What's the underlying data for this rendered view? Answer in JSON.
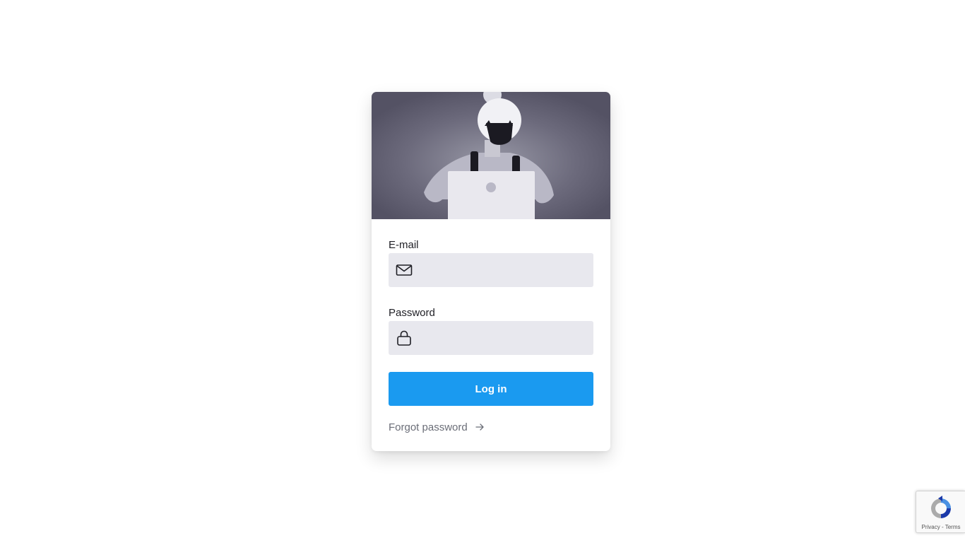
{
  "login": {
    "email_label": "E-mail",
    "email_value": "",
    "password_label": "Password",
    "password_value": "",
    "submit_label": "Log in",
    "forgot_label": "Forgot password"
  },
  "icons": {
    "email": "envelope-icon",
    "password": "lock-icon",
    "forgot": "arrow-right-icon",
    "recaptcha": "recaptcha-logo"
  },
  "recaptcha": {
    "privacy_label": "Privacy",
    "separator": "-",
    "terms_label": "Terms"
  },
  "colors": {
    "primary": "#1a9af0",
    "input_bg": "#e8e8ee",
    "hero_bg": "#545264"
  }
}
